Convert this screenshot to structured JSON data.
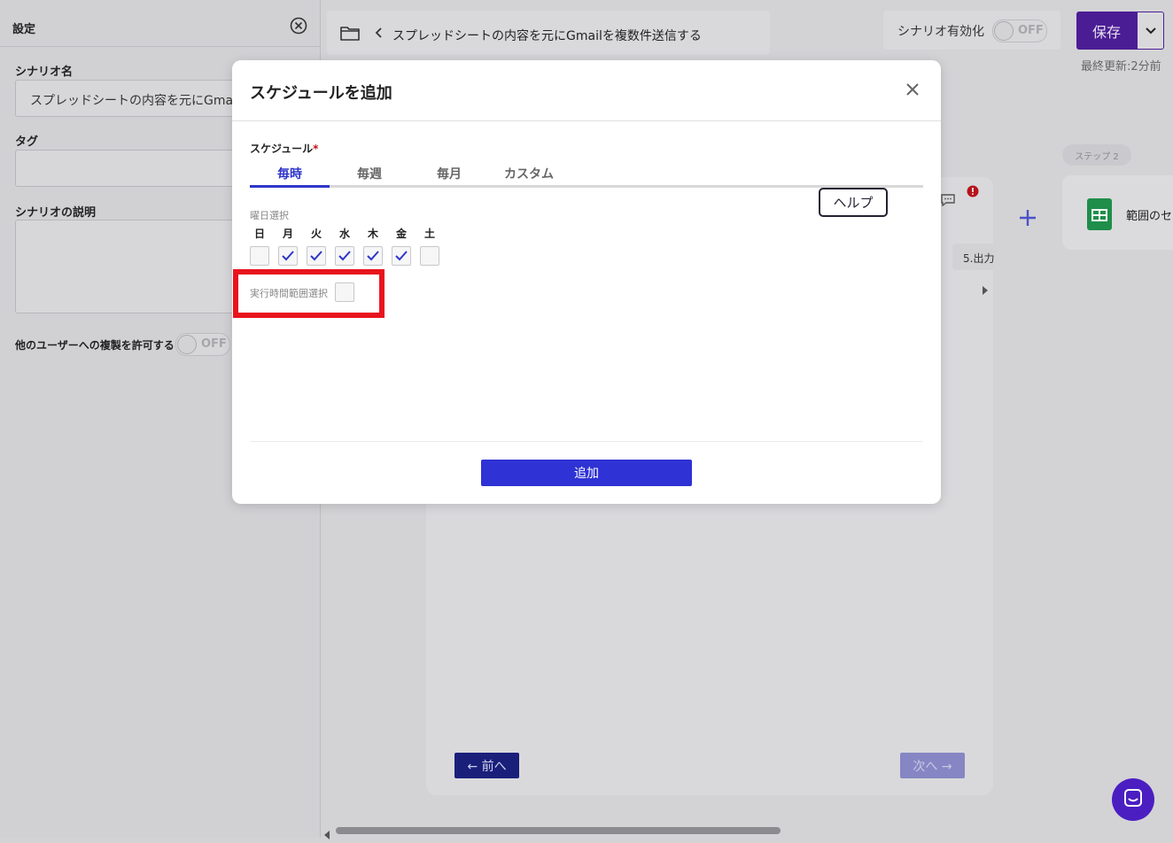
{
  "left_panel": {
    "title": "設定",
    "scenario_name_label": "シナリオ名",
    "scenario_name_value": "スプレッドシートの内容を元にGmai",
    "tag_label": "タグ",
    "description_label": "シナリオの説明",
    "allow_copy_label": "他のユーザーへの複製を許可する",
    "allow_copy_toggle": "OFF"
  },
  "header": {
    "scenario_title": "スプレッドシートの内容を元にGmailを複数件送信する",
    "enable_label": "シナリオ有効化",
    "enable_toggle": "OFF",
    "save_label": "保存",
    "last_updated": "最終更新:2分前"
  },
  "canvas": {
    "step2_pill": "ステップ 2",
    "step2_title": "範囲のセ",
    "output_chip": "5.出力",
    "prev_label": "← 前へ",
    "next_label": "次へ →"
  },
  "modal": {
    "title": "スケジュールを追加",
    "schedule_label": "スケジュール",
    "required_mark": "*",
    "tabs": [
      "毎時",
      "毎週",
      "毎月",
      "カスタム"
    ],
    "active_tab": "毎時",
    "help_label": "ヘルプ",
    "weekday_section": "曜日選択",
    "days": [
      {
        "label": "日",
        "checked": false
      },
      {
        "label": "月",
        "checked": true
      },
      {
        "label": "火",
        "checked": true
      },
      {
        "label": "水",
        "checked": true
      },
      {
        "label": "木",
        "checked": true
      },
      {
        "label": "金",
        "checked": true
      },
      {
        "label": "土",
        "checked": false
      }
    ],
    "time_range_label": "実行時間範囲選択",
    "time_range_checked": false,
    "add_label": "追加"
  },
  "colors": {
    "accent": "#2e36c8",
    "save_purple": "#4b1d94",
    "highlight_red": "#e8141d"
  }
}
